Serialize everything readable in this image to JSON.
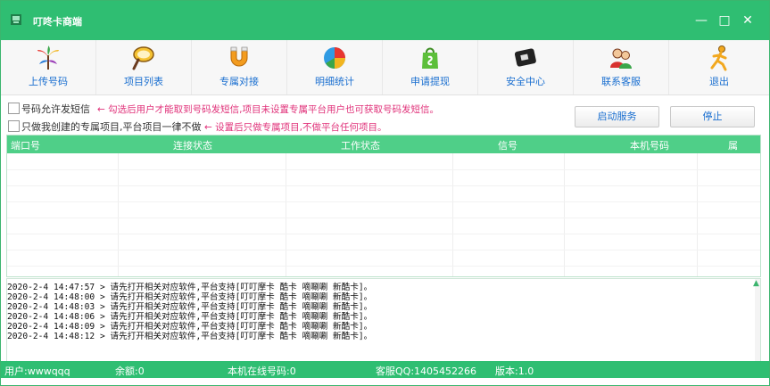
{
  "window": {
    "title": "叮咚卡商端",
    "minimize": "—",
    "maximize": "□",
    "close": "✕"
  },
  "toolbar": [
    {
      "label": "上传号码",
      "icon": "upload-leaves-icon"
    },
    {
      "label": "项目列表",
      "icon": "magnifier-icon"
    },
    {
      "label": "专属对接",
      "icon": "horseshoe-magnet-icon"
    },
    {
      "label": "明细统计",
      "icon": "pie-chart-icon"
    },
    {
      "label": "申请提现",
      "icon": "shopping-bag-icon"
    },
    {
      "label": "安全中心",
      "icon": "chip-card-icon"
    },
    {
      "label": "联系客服",
      "icon": "customer-service-icon"
    },
    {
      "label": "退出",
      "icon": "running-person-icon"
    }
  ],
  "options": {
    "allow_sms": {
      "label": "号码允许发短信",
      "checked": false,
      "hint": "← 勾选后用户才能取到号码发短信,项目未设置专属平台用户也可获取号码发短信。"
    },
    "exclusive_only": {
      "label": "只做我创建的专属项目,平台项目一律不做",
      "checked": false,
      "hint": "← 设置后只做专属项目,不做平台任何项目。"
    }
  },
  "buttons": {
    "start": "启动服务",
    "stop": "停止"
  },
  "table": {
    "columns": [
      "端口号",
      "连接状态",
      "工作状态",
      "信号",
      "本机号码",
      "属"
    ],
    "rows": []
  },
  "log": [
    "2020-2-4 14:47:57 > 请先打开相关对应软件,平台支持[叮叮摩卡 酷卡 嘀唰唰 新酷卡]。",
    "2020-2-4 14:48:00 > 请先打开相关对应软件,平台支持[叮叮摩卡 酷卡 嘀唰唰 新酷卡]。",
    "2020-2-4 14:48:03 > 请先打开相关对应软件,平台支持[叮叮摩卡 酷卡 嘀唰唰 新酷卡]。",
    "2020-2-4 14:48:06 > 请先打开相关对应软件,平台支持[叮叮摩卡 酷卡 嘀唰唰 新酷卡]。",
    "2020-2-4 14:48:09 > 请先打开相关对应软件,平台支持[叮叮摩卡 酷卡 嘀唰唰 新酷卡]。",
    "2020-2-4 14:48:12 > 请先打开相关对应软件,平台支持[叮叮摩卡 酷卡 嘀唰唰 新酷卡]。"
  ],
  "status": {
    "user": "用户:wwwqqq",
    "balance": "余额:0",
    "online": "本机在线号码:0",
    "qq": "客服QQ:1405452266",
    "version": "版本:1.0"
  },
  "colors": {
    "accent": "#2fbe72",
    "header": "#4fcf88",
    "link": "#1a6fd0",
    "hint": "#e0327a"
  }
}
